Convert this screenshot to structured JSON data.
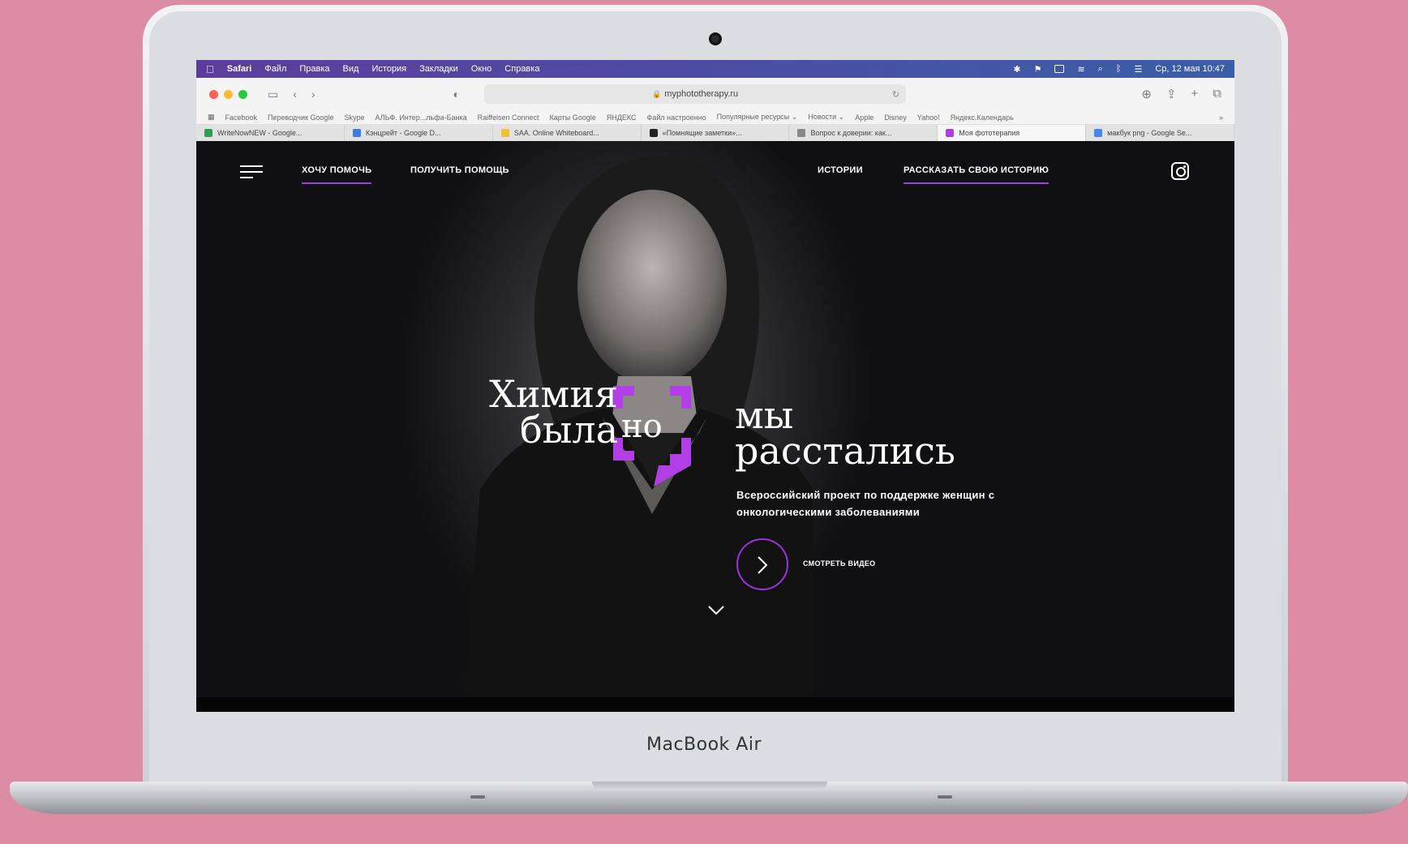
{
  "device": {
    "label": "MacBook Air"
  },
  "menubar": {
    "items": [
      "Safari",
      "Файл",
      "Правка",
      "Вид",
      "История",
      "Закладки",
      "Окно",
      "Справка"
    ],
    "datetime": "Ср, 12 мая 10:47"
  },
  "browser": {
    "url": "myphototherapy.ru",
    "bookmarks": [
      "Facebook",
      "Переводчик Google",
      "Skype",
      "АЛЬФ. Интер...льфа-Банка",
      "Raiffeisen Connect",
      "Карты Google",
      "ЯНДЕКС",
      "Файл настроенно",
      "Популярные ресурсы ⌄",
      "Новости ⌄",
      "Apple",
      "Disney",
      "Yahoo!",
      "Яндекс.Календарь"
    ],
    "bookmarks_more": "»",
    "tabs": [
      {
        "label": "WriteNowNEW - Google...",
        "color": "#2e9e4f"
      },
      {
        "label": "Кэнцрейт - Google D...",
        "color": "#3d7be0"
      },
      {
        "label": "SAA. Online Whiteboard...",
        "color": "#f0c030"
      },
      {
        "label": "«Помнящие заметки»...",
        "color": "#222222"
      },
      {
        "label": "Вопрос к доверии: как...",
        "color": "#888888"
      },
      {
        "label": "Моя фототерапия",
        "color": "#b03ee0"
      },
      {
        "label": "макбук png - Google Se...",
        "color": "#4285f4"
      }
    ]
  },
  "site": {
    "nav": {
      "help_give": "ХОЧУ ПОМОЧЬ",
      "help_get": "ПОЛУЧИТЬ ПОМОЩЬ",
      "stories": "ИСТОРИИ",
      "tell_story": "РАССКАЗАТЬ СВОЮ ИСТОРИЮ"
    },
    "headline": {
      "line1": "Химия",
      "line2": "была",
      "middle": "но",
      "line3": "мы",
      "line4": "расстались"
    },
    "subtitle": "Всероссийский проект по поддержке женщин с онкологическими заболеваниями",
    "video_label": "СМОТРЕТЬ ВИДЕО",
    "accent_color": "#9b3de0"
  }
}
